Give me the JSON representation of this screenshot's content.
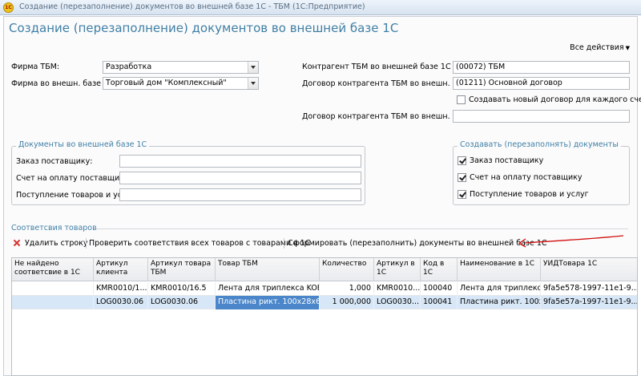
{
  "window": {
    "title": "Создание (перезаполнение) документов во внешней базе 1С - ТБМ  (1С:Предприятие)",
    "logo_text": "1С"
  },
  "page_title": "Создание (перезаполнение) документов во внешней базе 1С",
  "all_actions": "Все действия",
  "left_fields": {
    "firm_label": "Фирма ТБМ:",
    "firm_value": "Разработка",
    "ext_firm_label": "Фирма во внешн. базе 1С:",
    "ext_firm_value": "Торговый дом \"Комплексный\""
  },
  "right_fields": {
    "contractor_label": "Контрагент ТБМ во внешней базе 1С",
    "contractor_value": "(00072) ТБМ",
    "contract_label": "Договор контрагента ТБМ во внешн. базе:",
    "contract_value": "(01211) Основной договор",
    "new_contract_label": "Создавать новый договор для каждого счета",
    "new_contract_checked": false,
    "contract2_label": "Договор контрагента ТБМ во внешн. базе:",
    "contract2_value": ""
  },
  "docs_group": {
    "title": "Документы во внешней базе 1С",
    "rows": [
      {
        "label": "Заказ поставщику:",
        "value": ""
      },
      {
        "label": "Счет на оплату поставщику :",
        "value": ""
      },
      {
        "label": "Поступление товаров и услуг:",
        "value": ""
      }
    ]
  },
  "create_group": {
    "title": "Создавать (перезаполнять) документы",
    "items": [
      {
        "label": "Заказ поставщику",
        "checked": true
      },
      {
        "label": "Счет на оплату поставщику",
        "checked": true
      },
      {
        "label": "Поступление товаров и услуг",
        "checked": true
      }
    ]
  },
  "section_title": "Соответсвия товаров",
  "toolbar": {
    "delete_row": "Удалить строку",
    "check_matches": "Проверить соответствия всех товаров с товарами в 1С",
    "form_docs": "Сформировать (перезаполнить) документы во внешней базе 1С"
  },
  "table": {
    "columns": [
      "Не найдено соответсвие в 1С",
      "Артикул клиента",
      "Артикул товара ТБМ",
      "Товар ТБМ",
      "Количество",
      "Артикул в 1С",
      "Код в 1С",
      "Наименование в 1С",
      "УИДТовара 1С"
    ],
    "rows": [
      [
        "",
        "KMR0010/1...",
        "KMR0010/16.5",
        "Лента для триплекса KOE-...",
        "1,000",
        "KMR0010...",
        "100040",
        "Лента для триплекс...",
        "9fa5e578-1997-11e1-9..."
      ],
      [
        "",
        "LOG0030.06",
        "LOG0030.06",
        "Пластина рикт. 100х28х6 ч...",
        "1 000,000",
        "LOG0030...",
        "100041",
        "Пластина рикт. 100х...",
        "9fa5e57a-1997-11e1-9..."
      ]
    ]
  },
  "colors": {
    "accent": "#3f7fa6",
    "selection": "#d7e7f7",
    "focus_cell": "#4a86c9",
    "annotation": "#d01010"
  }
}
